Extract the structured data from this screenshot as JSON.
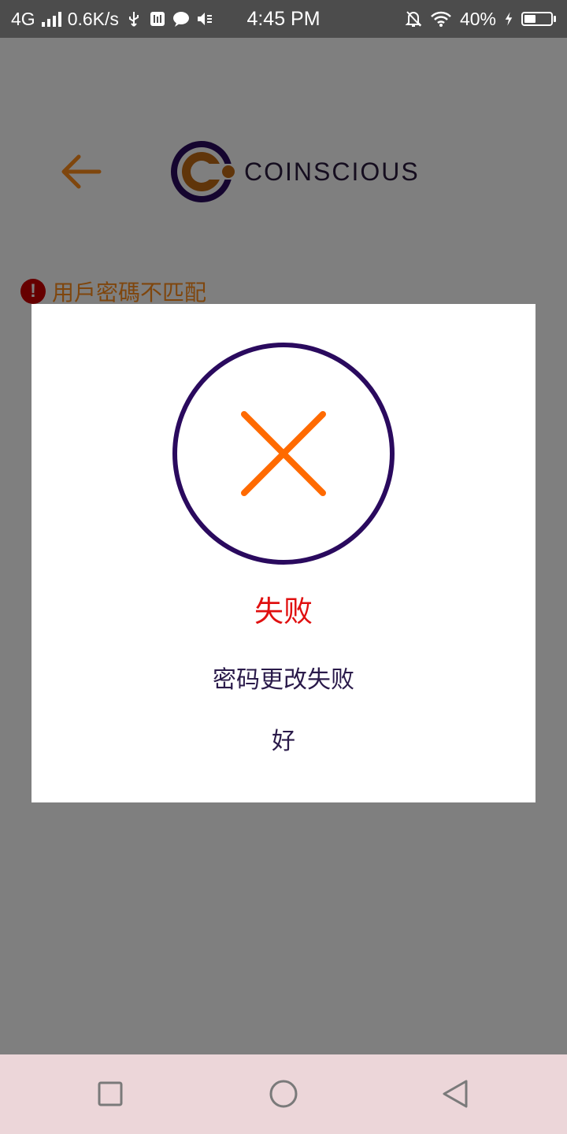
{
  "status_bar": {
    "network": "4G",
    "speed": "0.6K/s",
    "time": "4:45 PM",
    "battery": "40%",
    "icons": [
      "signal-icon",
      "usb-icon",
      "usb-debug-icon",
      "message-icon",
      "speaker-mute-icon",
      "bell-off-icon",
      "wifi-icon",
      "charging-icon",
      "battery-icon"
    ]
  },
  "header": {
    "back_icon": "arrow-left-icon",
    "brand": "COINSCIOUS"
  },
  "form": {
    "error_text": "用戶密碼不匹配"
  },
  "dialog": {
    "icon": "failure-x-icon",
    "title": "失败",
    "message": "密码更改失败",
    "ok_label": "好"
  },
  "nav": {
    "recent_icon": "square-icon",
    "home_icon": "circle-icon",
    "back_icon": "triangle-back-icon"
  },
  "colors": {
    "accent_orange": "#ff6a00",
    "brand_purple": "#2a0a5e",
    "error_red": "#e01010",
    "overlay": "rgba(0,0,0,0.5)",
    "nav_bar": "#ecd6d9"
  }
}
